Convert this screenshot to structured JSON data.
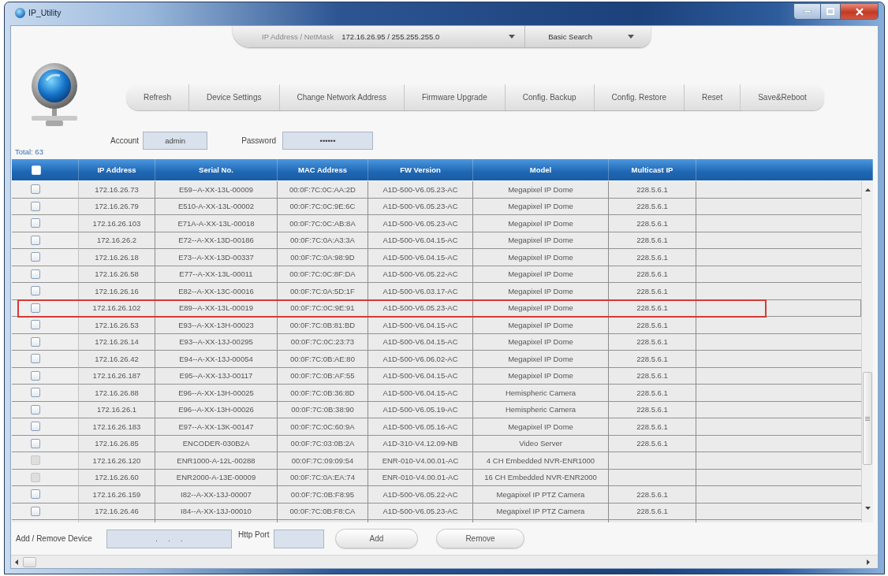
{
  "window": {
    "title": "IP_Utility"
  },
  "search": {
    "label": "IP Address / NetMask",
    "value": "172.16.26.95 / 255.255.255.0",
    "mode": "Basic Search"
  },
  "toolbar": [
    "Refresh",
    "Device Settings",
    "Change Network Address",
    "Firmware Upgrade",
    "Config. Backup",
    "Config. Restore",
    "Reset",
    "Save&Reboot"
  ],
  "login": {
    "account_label": "Account",
    "account": "admin",
    "password_label": "Password",
    "password": "••••••"
  },
  "total": "Total: 63",
  "table": {
    "select_all": {
      "checked": false
    },
    "columns": [
      "IP Address",
      "Serial No.",
      "MAC Address",
      "FW Version",
      "Model",
      "Multicast IP"
    ],
    "rows": [
      {
        "checked": false,
        "disabled": false,
        "highlighted": false,
        "cells": [
          "172.16.26.73",
          "E59--A-XX-13L-00009",
          "00:0F:7C:0C:AA:2D",
          "A1D-500-V6.05.23-AC",
          "Megapixel IP Dome",
          "228.5.6.1"
        ]
      },
      {
        "checked": false,
        "disabled": false,
        "highlighted": false,
        "cells": [
          "172.16.26.79",
          "E510-A-XX-13L-00002",
          "00:0F:7C:0C:9E:6C",
          "A1D-500-V6.05.23-AC",
          "Megapixel IP Dome",
          "228.5.6.1"
        ]
      },
      {
        "checked": false,
        "disabled": false,
        "highlighted": false,
        "cells": [
          "172.16.26.103",
          "E71A-A-XX-13L-00018",
          "00:0F:7C:0C:AB:8A",
          "A1D-500-V6.05.23-AC",
          "Megapixel IP Dome",
          "228.5.6.1"
        ]
      },
      {
        "checked": false,
        "disabled": false,
        "highlighted": false,
        "cells": [
          "172.16.26.2",
          "E72--A-XX-13D-00186",
          "00:0F:7C:0A:A3:3A",
          "A1D-500-V6.04.15-AC",
          "Megapixel IP Dome",
          "228.5.6.1"
        ]
      },
      {
        "checked": false,
        "disabled": false,
        "highlighted": false,
        "cells": [
          "172.16.26.18",
          "E73--A-XX-13D-00337",
          "00:0F:7C:0A:98:9D",
          "A1D-500-V6.04.15-AC",
          "Megapixel IP Dome",
          "228.5.6.1"
        ]
      },
      {
        "checked": false,
        "disabled": false,
        "highlighted": false,
        "cells": [
          "172.16.26.58",
          "E77--A-XX-13L-00011",
          "00:0F:7C:0C:8F:DA",
          "A1D-500-V6.05.22-AC",
          "Megapixel IP Dome",
          "228.5.6.1"
        ]
      },
      {
        "checked": false,
        "disabled": false,
        "highlighted": false,
        "cells": [
          "172.16.26.16",
          "E82--A-XX-13C-00016",
          "00:0F:7C:0A:5D:1F",
          "A1D-500-V6.03.17-AC",
          "Megapixel IP Dome",
          "228.5.6.1"
        ]
      },
      {
        "checked": false,
        "disabled": false,
        "highlighted": true,
        "cells": [
          "172.16.26.102",
          "E89--A-XX-13L-00019",
          "00:0F:7C:0C:9E:91",
          "A1D-500-V6.05.23-AC",
          "Megapixel IP Dome",
          "228.5.6.1"
        ]
      },
      {
        "checked": false,
        "disabled": false,
        "highlighted": false,
        "cells": [
          "172.16.26.53",
          "E93--A-XX-13H-00023",
          "00:0F:7C:0B:81:BD",
          "A1D-500-V6.04.15-AC",
          "Megapixel IP Dome",
          "228.5.6.1"
        ]
      },
      {
        "checked": false,
        "disabled": false,
        "highlighted": false,
        "cells": [
          "172.16.26.14",
          "E93--A-XX-13J-00295",
          "00:0F:7C:0C:23:73",
          "A1D-500-V6.04.15-AC",
          "Megapixel IP Dome",
          "228.5.6.1"
        ]
      },
      {
        "checked": false,
        "disabled": false,
        "highlighted": false,
        "cells": [
          "172.16.26.42",
          "E94--A-XX-13J-00054",
          "00:0F:7C:0B:AE:80",
          "A1D-500-V6.06.02-AC",
          "Megapixel IP Dome",
          "228.5.6.1"
        ]
      },
      {
        "checked": false,
        "disabled": false,
        "highlighted": false,
        "cells": [
          "172.16.26.187",
          "E95--A-XX-13J-00117",
          "00:0F:7C:0B:AF:55",
          "A1D-500-V6.04.15-AC",
          "Megapixel IP Dome",
          "228.5.6.1"
        ]
      },
      {
        "checked": false,
        "disabled": false,
        "highlighted": false,
        "cells": [
          "172.16.26.88",
          "E96--A-XX-13H-00025",
          "00:0F:7C:0B:36:8D",
          "A1D-500-V6.04.15-AC",
          "Hemispheric Camera",
          "228.5.6.1"
        ]
      },
      {
        "checked": false,
        "disabled": false,
        "highlighted": false,
        "cells": [
          "172.16.26.1",
          "E96--A-XX-13H-00026",
          "00:0F:7C:0B:38:90",
          "A1D-500-V6.05.19-AC",
          "Hemispheric Camera",
          "228.5.6.1"
        ]
      },
      {
        "checked": false,
        "disabled": false,
        "highlighted": false,
        "cells": [
          "172.16.26.183",
          "E97--A-XX-13K-00147",
          "00:0F:7C:0C:60:9A",
          "A1D-500-V6.05.16-AC",
          "Megapixel IP Dome",
          "228.5.6.1"
        ]
      },
      {
        "checked": false,
        "disabled": false,
        "highlighted": false,
        "cells": [
          "172.16.26.85",
          "ENCODER-030B2A",
          "00:0F:7C:03:0B:2A",
          "A1D-310-V4.12.09-NB",
          "Video Server",
          "228.5.6.1"
        ]
      },
      {
        "checked": false,
        "disabled": true,
        "highlighted": false,
        "cells": [
          "172.16.26.120",
          "ENR1000-A-12L-00288",
          "00:0F:7C:09:09:54",
          "ENR-010-V4.00.01-AC",
          "4 CH Embedded NVR-ENR1000"
        ]
      },
      {
        "checked": false,
        "disabled": true,
        "highlighted": false,
        "cells": [
          "172.16.26.60",
          "ENR2000-A-13E-00009",
          "00:0F:7C:0A:EA:74",
          "ENR-010-V4.00.01-AC",
          "16 CH Embedded NVR-ENR2000"
        ]
      },
      {
        "checked": false,
        "disabled": false,
        "highlighted": false,
        "cells": [
          "172.16.26.159",
          "I82--A-XX-13J-00007",
          "00:0F:7C:0B:F8:95",
          "A1D-500-V6.05.22-AC",
          "Megapixel IP PTZ Camera",
          "228.5.6.1"
        ]
      },
      {
        "checked": false,
        "disabled": false,
        "highlighted": false,
        "cells": [
          "172.16.26.46",
          "I84--A-XX-13J-00010",
          "00:0F:7C:0B:F8:CA",
          "A1D-500-V6.05.23-AC",
          "Megapixel IP PTZ Camera",
          "228.5.6.1"
        ]
      }
    ]
  },
  "add_device": {
    "label": "Add / Remove Device",
    "address": ".     .     .",
    "port_label": "Http Port",
    "buttons": [
      "Add",
      "Remove"
    ]
  }
}
